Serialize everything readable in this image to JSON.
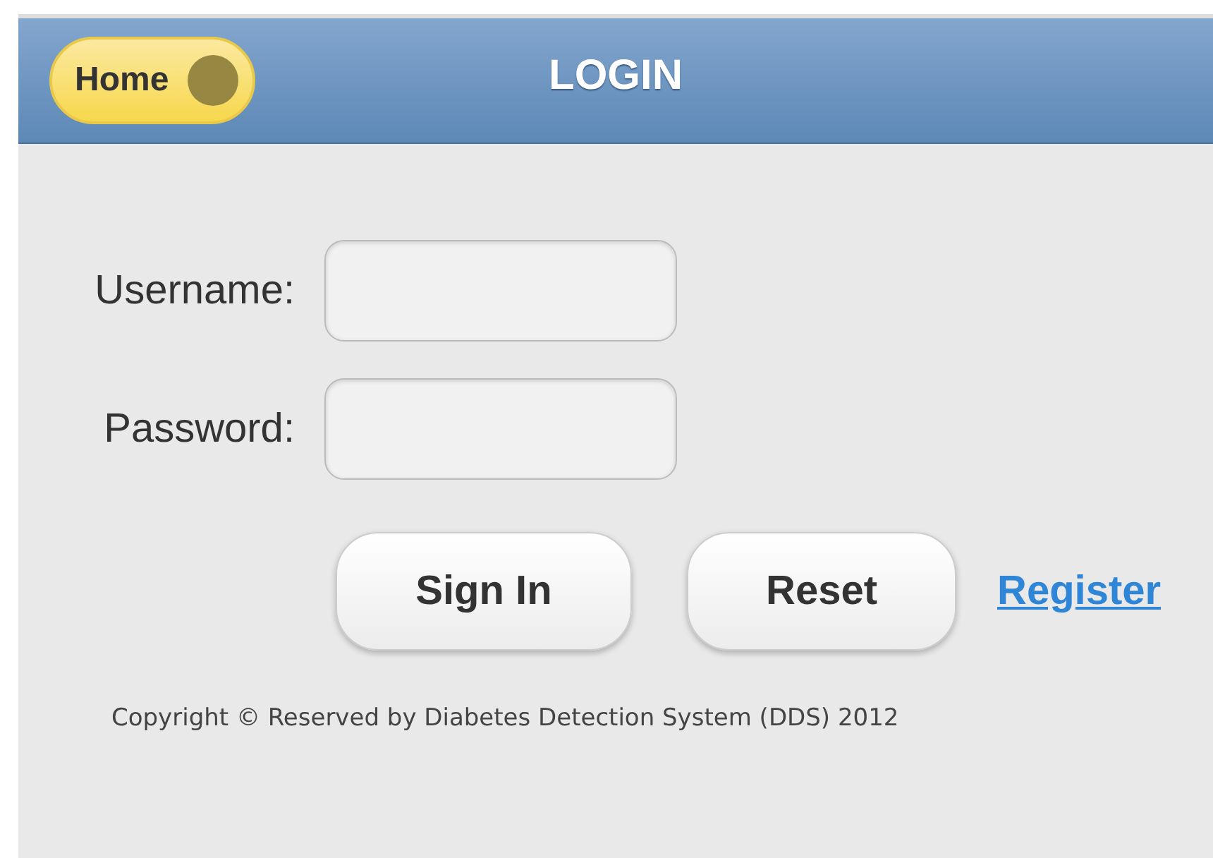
{
  "header": {
    "home_button": "Home",
    "title": "LOGIN"
  },
  "fields": [
    {
      "label": "Username:"
    },
    {
      "label": "Password:"
    }
  ],
  "buttons": [
    "Sign In",
    "Reset"
  ],
  "register_link": "Register",
  "footer": "Copyright © Reserved by Diabetes Detection System (DDS) 2012"
}
